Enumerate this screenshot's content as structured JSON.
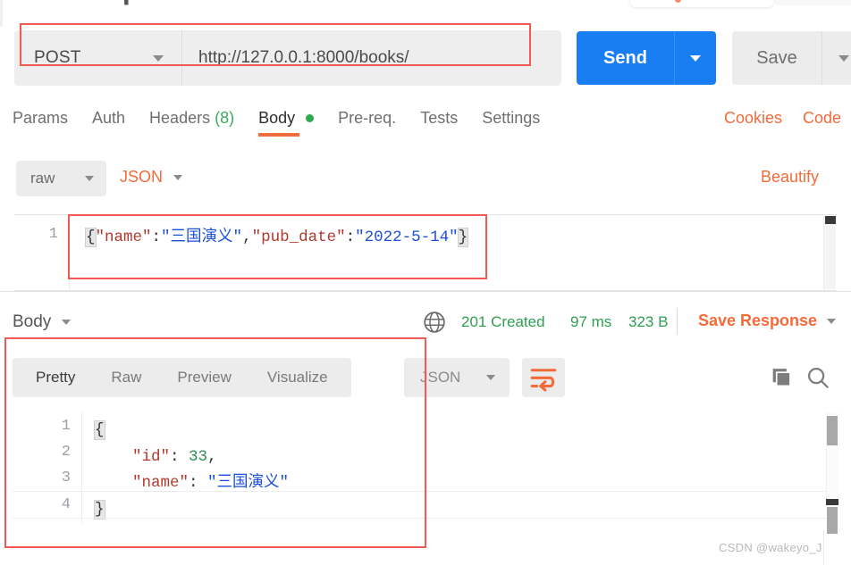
{
  "request": {
    "method": "POST",
    "url": "http://127.0.0.1:8000/books/",
    "send_label": "Send",
    "save_label": "Save",
    "tabs": [
      {
        "label": "Params",
        "badge": "",
        "active": false,
        "dot": false
      },
      {
        "label": "Auth",
        "badge": "",
        "active": false,
        "dot": false
      },
      {
        "label": "Headers",
        "badge": "(8)",
        "active": false,
        "dot": false
      },
      {
        "label": "Body",
        "badge": "",
        "active": true,
        "dot": true
      },
      {
        "label": "Pre-req.",
        "badge": "",
        "active": false,
        "dot": false
      },
      {
        "label": "Tests",
        "badge": "",
        "active": false,
        "dot": false
      },
      {
        "label": "Settings",
        "badge": "",
        "active": false,
        "dot": false
      }
    ],
    "cookies_link": "Cookies",
    "code_link": "Code",
    "body_type": "raw",
    "body_format": "JSON",
    "beautify_link": "Beautify",
    "editor": {
      "line_numbers": [
        "1"
      ],
      "raw_text": "{\"name\":\"三国演义\",\"pub_date\":\"2022-5-14\"}",
      "tokens": [
        {
          "t": "{",
          "c": "tok-brace"
        },
        {
          "t": "\"name\"",
          "c": "tok-key"
        },
        {
          "t": ":",
          "c": "tok-punct"
        },
        {
          "t": "\"三国演义\"",
          "c": "tok-str"
        },
        {
          "t": ",",
          "c": "tok-punct"
        },
        {
          "t": "\"pub_date\"",
          "c": "tok-key"
        },
        {
          "t": ":",
          "c": "tok-punct"
        },
        {
          "t": "\"2022-5-14\"",
          "c": "tok-str"
        },
        {
          "t": "}",
          "c": "tok-brace"
        }
      ]
    }
  },
  "response": {
    "body_selector": "Body",
    "status": "201 Created",
    "time": "97 ms",
    "size": "323 B",
    "save_response": "Save Response",
    "tabs": [
      {
        "label": "Pretty",
        "active": true
      },
      {
        "label": "Raw",
        "active": false
      },
      {
        "label": "Preview",
        "active": false
      },
      {
        "label": "Visualize",
        "active": false
      }
    ],
    "format": "JSON",
    "icons": {
      "globe": "globe-icon",
      "wrap": "wrap-text-icon",
      "copy": "copy-icon",
      "search": "search-icon"
    },
    "editor": {
      "line_numbers": [
        "1",
        "2",
        "3",
        "4"
      ],
      "lines": [
        [
          {
            "t": "{",
            "c": "tok-brace"
          }
        ],
        [
          {
            "t": "    ",
            "c": "tok-punct"
          },
          {
            "t": "\"id\"",
            "c": "tok-key"
          },
          {
            "t": ": ",
            "c": "tok-punct"
          },
          {
            "t": "33",
            "c": "tok-num"
          },
          {
            "t": ",",
            "c": "tok-punct"
          }
        ],
        [
          {
            "t": "    ",
            "c": "tok-punct"
          },
          {
            "t": "\"name\"",
            "c": "tok-key"
          },
          {
            "t": ": ",
            "c": "tok-punct"
          },
          {
            "t": "\"三国演义\"",
            "c": "tok-str"
          }
        ],
        [
          {
            "t": "}",
            "c": "tok-brace"
          }
        ]
      ],
      "json": {
        "id": 33,
        "name": "三国演义"
      }
    }
  },
  "annotations": {
    "accent_red": "#f05a52",
    "count": 3
  },
  "theme": {
    "send_blue": "#1a7ef3",
    "accent_orange": "#f26b3a",
    "status_green": "#2e9e52",
    "body_dot_green": "#2fab4f"
  },
  "watermark": "CSDN @wakeyo_J"
}
